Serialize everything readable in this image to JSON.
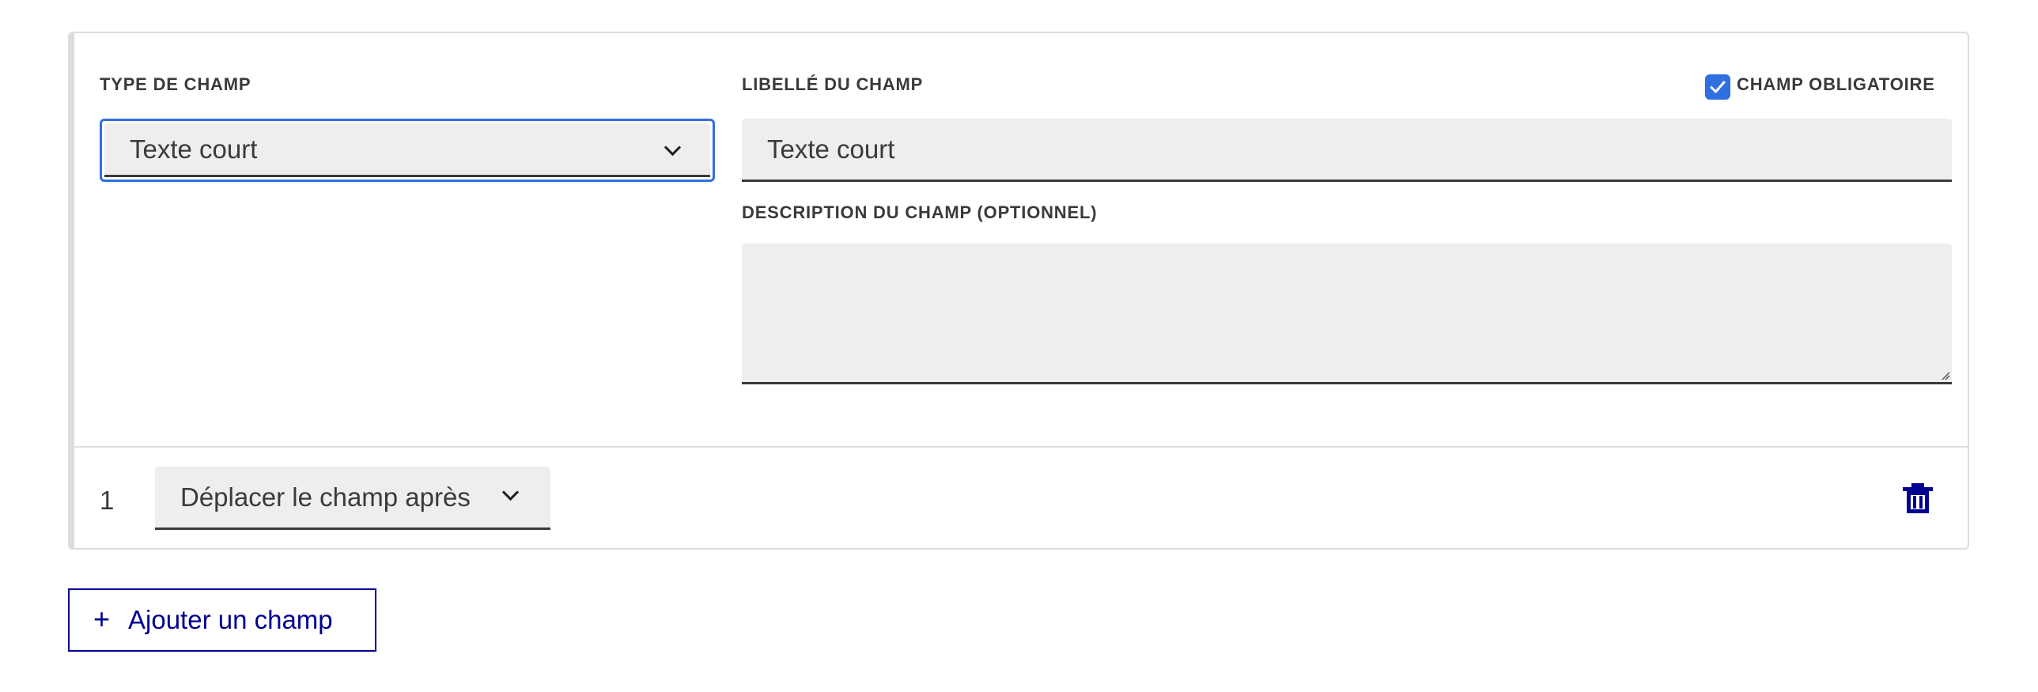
{
  "field_card": {
    "type_label": "TYPE DE CHAMP",
    "type_value": "Texte court",
    "label_label": "LIBELLÉ DU CHAMP",
    "label_value": "Texte court",
    "required_label": "CHAMP OBLIGATOIRE",
    "required_checked": true,
    "description_label": "DESCRIPTION DU CHAMP (OPTIONNEL)",
    "description_value": "",
    "order_number": "1",
    "move_select_value": "Déplacer le champ après"
  },
  "add_field_button": {
    "icon": "+",
    "label": "Ajouter un champ"
  },
  "colors": {
    "focus_blue": "#2f6fe0",
    "checkbox_blue": "#2f6fe0",
    "action_navy": "#000091",
    "field_bg": "#eeeeee"
  },
  "icons": {
    "select_chevron": "chevron-down-icon",
    "checkbox_mark": "check-icon",
    "delete": "trash-icon",
    "add": "plus-icon"
  }
}
